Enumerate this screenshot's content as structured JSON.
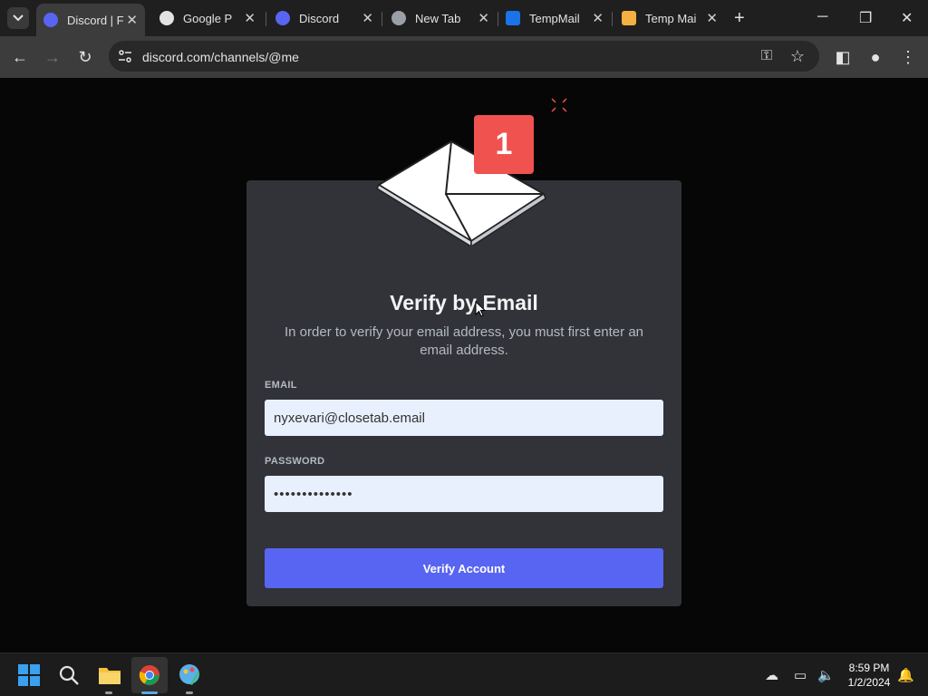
{
  "browser": {
    "tabs": [
      {
        "title": "Discord | F",
        "favicon": "discord-icon",
        "active": true
      },
      {
        "title": "Google Pa",
        "favicon": "google-password-icon",
        "active": false
      },
      {
        "title": "Discord",
        "favicon": "discord-icon",
        "active": false
      },
      {
        "title": "New Tab",
        "favicon": "chrome-icon",
        "active": false
      },
      {
        "title": "TempMail",
        "favicon": "tempmail-icon",
        "active": false
      },
      {
        "title": "Temp Mail",
        "favicon": "temp-mail-envelope-icon",
        "active": false
      }
    ],
    "url": "discord.com/channels/@me"
  },
  "modal": {
    "badge_count": "1",
    "title": "Verify by Email",
    "description": "In order to verify your email address, you must first enter an email address.",
    "email_label": "EMAIL",
    "email_value": "nyxevari@closetab.email",
    "password_label": "PASSWORD",
    "password_value": "••••••••••••••",
    "button_label": "Verify Account"
  },
  "taskbar": {
    "time": "8:59 PM",
    "date": "1/2/2024"
  },
  "colors": {
    "accent": "#5865f2",
    "badge": "#f0524f",
    "modal_bg": "#313338"
  }
}
